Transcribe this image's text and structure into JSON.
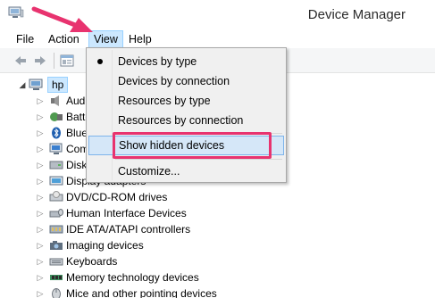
{
  "window": {
    "title": "Device Manager"
  },
  "menubar": {
    "items": [
      {
        "label": "File"
      },
      {
        "label": "Action"
      },
      {
        "label": "View"
      },
      {
        "label": "Help"
      }
    ]
  },
  "tree": {
    "root": {
      "label": "hp"
    },
    "nodes": [
      {
        "label": "Audio inputs and outputs",
        "icon": "speaker-icon"
      },
      {
        "label": "Batteries",
        "icon": "battery-icon"
      },
      {
        "label": "Bluetooth",
        "icon": "bluetooth-icon"
      },
      {
        "label": "Computer",
        "icon": "computer-icon"
      },
      {
        "label": "Disk drives",
        "icon": "disk-drive-icon"
      },
      {
        "label": "Display adapters",
        "icon": "display-adapter-icon"
      },
      {
        "label": "DVD/CD-ROM drives",
        "icon": "dvd-drive-icon"
      },
      {
        "label": "Human Interface Devices",
        "icon": "hid-icon"
      },
      {
        "label": "IDE ATA/ATAPI controllers",
        "icon": "ide-controller-icon"
      },
      {
        "label": "Imaging devices",
        "icon": "camera-icon"
      },
      {
        "label": "Keyboards",
        "icon": "keyboard-icon"
      },
      {
        "label": "Memory technology devices",
        "icon": "memory-icon"
      },
      {
        "label": "Mice and other pointing devices",
        "icon": "mouse-icon"
      }
    ]
  },
  "view_menu": {
    "items": [
      {
        "label": "Devices by type",
        "checked": true
      },
      {
        "label": "Devices by connection",
        "checked": false
      },
      {
        "label": "Resources by type",
        "checked": false
      },
      {
        "label": "Resources by connection",
        "checked": false
      },
      {
        "label": "Show hidden devices",
        "checked": false,
        "highlighted": true
      },
      {
        "label": "Customize...",
        "checked": false
      }
    ]
  },
  "colors": {
    "callout": "#e8336f",
    "menu_highlight": "#d5e7f8",
    "selection": "#cce8ff"
  }
}
